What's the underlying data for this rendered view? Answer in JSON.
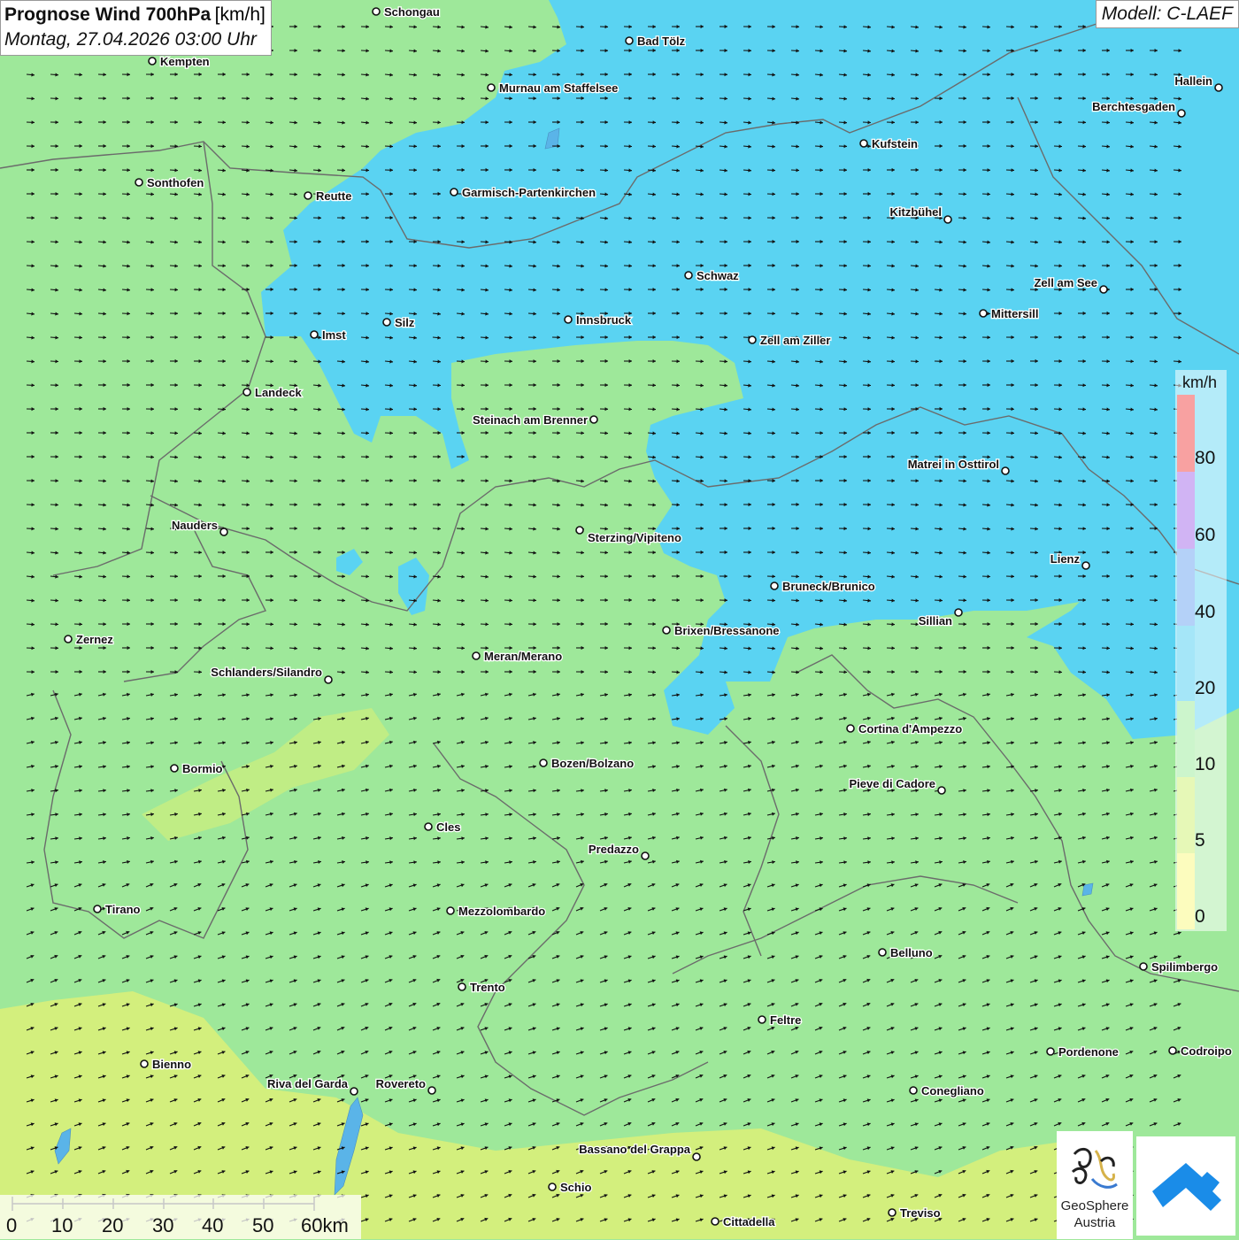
{
  "header": {
    "title": "Prognose Wind 700hPa",
    "unit": "[km/h]",
    "datetime": "Montag, 27.04.2026 03:00 Uhr",
    "model": "Modell: C-LAEF"
  },
  "legend": {
    "unit": "km/h",
    "steps": [
      {
        "label": "80",
        "color": "#f03030"
      },
      {
        "label": "60",
        "color": "#9a5ae6"
      },
      {
        "label": "40",
        "color": "#5a9af0"
      },
      {
        "label": "20",
        "color": "#38c8f0"
      },
      {
        "label": "10",
        "color": "#8ee88e"
      },
      {
        "label": "5",
        "color": "#c8f060"
      },
      {
        "label": "0",
        "color": "#f8f870"
      }
    ]
  },
  "scale_bar": {
    "labels": [
      "0",
      "10",
      "20",
      "30",
      "40",
      "50",
      "60km"
    ]
  },
  "logos": {
    "geosphere_line1": "GeoSphere",
    "geosphere_line2": "Austria"
  },
  "colors": {
    "calm_green": "#9ee89a",
    "wind_blue": "#5ad3f2",
    "light_yellow": "#d8f07a",
    "border_gray": "#6b6b6b",
    "arrow_black": "#111111"
  },
  "wind": {
    "direction": "west-southwest to east-northeast"
  },
  "places": [
    {
      "name": "Schongau"
    },
    {
      "name": "Bad Tölz"
    },
    {
      "name": "Kempten"
    },
    {
      "name": "Murnau am Staffelsee"
    },
    {
      "name": "Hallein"
    },
    {
      "name": "Berchtesgaden"
    },
    {
      "name": "Kufstein"
    },
    {
      "name": "Sonthofen"
    },
    {
      "name": "Reutte"
    },
    {
      "name": "Garmisch-Partenkirchen"
    },
    {
      "name": "Kitzbühel"
    },
    {
      "name": "Schwaz"
    },
    {
      "name": "Zell am See"
    },
    {
      "name": "Silz"
    },
    {
      "name": "Innsbruck"
    },
    {
      "name": "Mittersill"
    },
    {
      "name": "Imst"
    },
    {
      "name": "Zell am Ziller"
    },
    {
      "name": "Landeck"
    },
    {
      "name": "Steinach am Brenner"
    },
    {
      "name": "Matrei in Osttirol"
    },
    {
      "name": "Nauders"
    },
    {
      "name": "Sterzing/Vipiteno"
    },
    {
      "name": "Lienz"
    },
    {
      "name": "Bruneck/Brunico"
    },
    {
      "name": "Sillian"
    },
    {
      "name": "Zernez"
    },
    {
      "name": "Brixen/Bressanone"
    },
    {
      "name": "Meran/Merano"
    },
    {
      "name": "Schlanders/Silandro"
    },
    {
      "name": "Cortina d'Ampezzo"
    },
    {
      "name": "Bormio"
    },
    {
      "name": "Bozen/Bolzano"
    },
    {
      "name": "Pieve di Cadore"
    },
    {
      "name": "Cles"
    },
    {
      "name": "Predazzo"
    },
    {
      "name": "Tirano"
    },
    {
      "name": "Mezzolombardo"
    },
    {
      "name": "Belluno"
    },
    {
      "name": "Spilimbergo"
    },
    {
      "name": "Trento"
    },
    {
      "name": "Feltre"
    },
    {
      "name": "Pordenone"
    },
    {
      "name": "Codroipo"
    },
    {
      "name": "Bienno"
    },
    {
      "name": "Riva del Garda"
    },
    {
      "name": "Rovereto"
    },
    {
      "name": "Conegliano"
    },
    {
      "name": "Bassano del Grappa"
    },
    {
      "name": "Schio"
    },
    {
      "name": "Treviso"
    },
    {
      "name": "Cittadella"
    }
  ]
}
